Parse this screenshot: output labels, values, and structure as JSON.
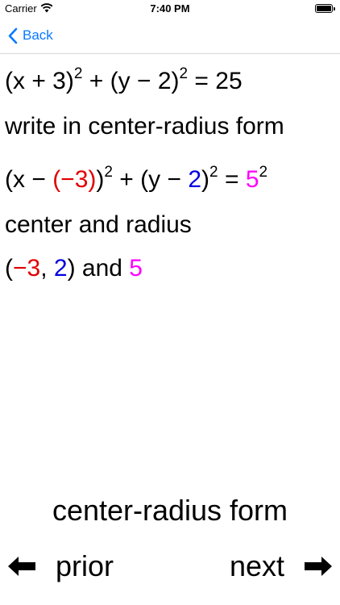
{
  "status": {
    "carrier": "Carrier",
    "time": "7:40 PM"
  },
  "nav": {
    "back_label": "Back"
  },
  "content": {
    "equation": {
      "p1": "(x + 3)",
      "e1": "2",
      "plus": " + ",
      "p2": "(y − 2)",
      "e2": "2",
      "rhs": " = 25"
    },
    "instruction": "write in center-radius form",
    "form": {
      "open": "(x − ",
      "h": "(−3)",
      "close1": ")",
      "e1": "2",
      "plus": " + ",
      "open2": "(y − ",
      "k": "2",
      "close2": ")",
      "e2": "2",
      "eq": " = ",
      "r": "5",
      "e3": "2"
    },
    "label": "center and radius",
    "result": {
      "open": "(",
      "h": "−3",
      "comma": ", ",
      "k": "2",
      "close": ") and ",
      "r": "5"
    }
  },
  "footer": {
    "title": "center-radius form",
    "prior_label": "prior",
    "next_label": "next"
  },
  "colors": {
    "accent": "#0a7aff",
    "h_color": "#e00000",
    "k_color": "#0000e0",
    "r_color": "#ff00ff"
  }
}
